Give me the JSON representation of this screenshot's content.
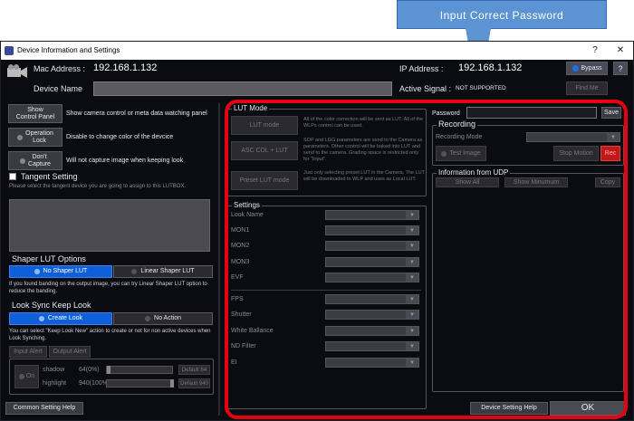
{
  "callout": "Input Correct Password",
  "window": {
    "title": "Device Information and Settings",
    "help": "?",
    "close": "✕"
  },
  "header": {
    "mac_label": "Mac Address :",
    "mac_value": "192.168.1.132",
    "ip_label": "IP Address :",
    "ip_value": "192.168.1.132",
    "bypass": "Bypass",
    "help": "?",
    "device_name_label": "Device Name",
    "device_name_value": "",
    "active_signal_label": "Active Signal :",
    "active_signal_value": "NOT SUPPORTED",
    "find_me": "Find Me"
  },
  "left": {
    "show_panel": {
      "button": "Show\nControl Panel",
      "desc": "Show camera control or meta data watching panel"
    },
    "op_lock": {
      "button": "Operation\nLock",
      "desc": "Disable to change color of the devcice"
    },
    "dont_capture": {
      "button": "Don't\nCapture",
      "desc": "Will not capture image when keeping look"
    },
    "tangent": {
      "title": "Tangent Setting",
      "desc": "Please select the tangent device you are going to assign to this LUTBOX."
    },
    "shaper": {
      "title": "Shaper LUT Options",
      "opt1": "No Shaper LUT",
      "opt2": "Linear Shaper LUT",
      "desc": "If you found banding on the output image, you can try Linear Shaper LUT option to reduce the banding."
    },
    "look_sync": {
      "title": "Look Sync Keep Look",
      "opt1": "Create Look",
      "opt2": "No Action",
      "desc": "You can select \"Keep Look New\" action to create or not for non active devices when Look Synching."
    },
    "alert_tabs": [
      "Input Alert",
      "Output Alert"
    ],
    "alert": {
      "on_label": "On",
      "shadow_label": "shadow",
      "shadow_value": "64(0%)",
      "shadow_fraction": 0.0,
      "shadow_default": "Default 64",
      "highlight_label": "highlight",
      "highlight_value": "940(100%)",
      "highlight_fraction": 1.0,
      "highlight_default": "Default 940"
    },
    "common_help": "Common Setting Help"
  },
  "lut_mode": {
    "title": "LUT Mode",
    "items": [
      {
        "button": "LUT mode",
        "desc": "All of the color correction will be sent as LUT. All of the WLPs control can be used."
      },
      {
        "button": "ASC CDL + LUT",
        "desc": "SOP and LGG parameters are send to the Camera as parameters. Other control will be baked into LUT and send to the camera. Grading space is restricted only for \"Input\"."
      },
      {
        "button": "Preset LUT mode",
        "desc": "Just only selecting preset LUT in the Camera. The LUT will be downloaded to WLP and uses as Local LUT."
      }
    ]
  },
  "settings": {
    "title": "Settings",
    "rows1": [
      "Look Name",
      "MON1",
      "MON2",
      "MON3",
      "EVF"
    ],
    "rows2": [
      "FPS",
      "Shutter",
      "White Ballance",
      "ND Filter",
      "EI"
    ]
  },
  "password": {
    "label": "Password",
    "value": "",
    "save": "Save"
  },
  "recording": {
    "title": "Recording",
    "mode_label": "Recording Mode",
    "test_image": "Test Image",
    "stop_motion": "Stop Motion",
    "rec": "Rec"
  },
  "udp": {
    "title": "Information from UDP",
    "show_all": "Show All",
    "show_min": "Show Minumum",
    "copy": "Copy"
  },
  "footer": {
    "device_help": "Device Setting Help",
    "ok": "OK"
  },
  "colors": {
    "accent": "#0f5fd8",
    "rec": "#d42020",
    "highlight": "#e8000f",
    "callout": "#5b93d3"
  }
}
